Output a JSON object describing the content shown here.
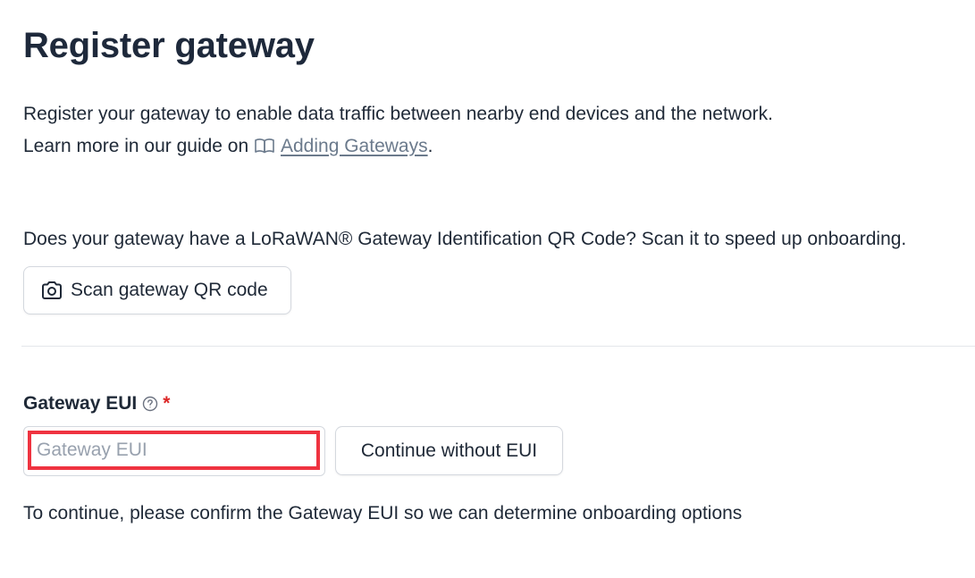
{
  "page": {
    "title": "Register gateway"
  },
  "intro": {
    "line1": "Register your gateway to enable data traffic between nearby end devices and the network.",
    "line2_prefix": "Learn more in our guide on ",
    "guide_icon": "book-icon",
    "guide_link": "Adding Gateways",
    "line2_suffix": "."
  },
  "qr": {
    "question": "Does your gateway have a LoRaWAN® Gateway Identification QR Code? Scan it to speed up onboarding.",
    "button_icon": "camera-icon",
    "button_label": "Scan gateway QR code"
  },
  "eui_field": {
    "label": "Gateway EUI",
    "help_icon": "question-circle-icon",
    "required_marker": "*",
    "value": "",
    "placeholder": "Gateway EUI",
    "continue_label": "Continue without EUI",
    "hint": "To continue, please confirm the Gateway EUI so we can determine onboarding options"
  },
  "colors": {
    "text": "#1f2937",
    "link": "#6b7a8c",
    "required": "#dc2626",
    "focus_highlight": "#ef3340",
    "border": "#d4d8de"
  }
}
